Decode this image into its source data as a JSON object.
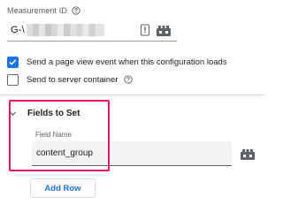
{
  "measurement_id": {
    "label": "Measurement ID",
    "value_prefix": "G-\\",
    "value_redacted": true,
    "help_icon": "help-circle-icon",
    "value_icon": "variable-id-icon",
    "variable_icon": "variable-picker-icon"
  },
  "options": [
    {
      "label": "Send a page view event when this configuration loads",
      "checked": true
    },
    {
      "label": "Send to server container",
      "checked": false,
      "help_icon": "help-circle-icon"
    }
  ],
  "fields_to_set": {
    "title": "Fields to Set",
    "expander_icon": "chevron-down-icon",
    "column_label": "Field Name",
    "rows": [
      {
        "field_name": "content_group",
        "variable_icon": "variable-picker-icon"
      }
    ],
    "add_row_label": "Add Row"
  },
  "colors": {
    "accent": "#1a73e8",
    "highlight": "#e3106a",
    "text": "#202124",
    "muted": "#5f6368"
  }
}
